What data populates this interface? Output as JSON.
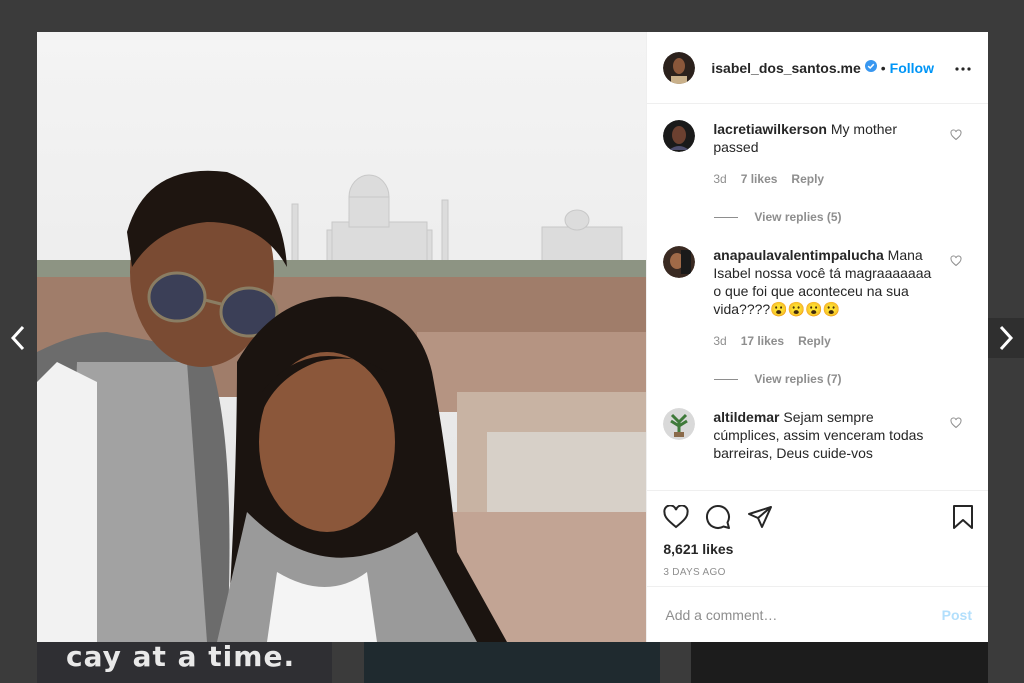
{
  "background": {
    "story_text": "cay at a time."
  },
  "post": {
    "author": {
      "username": "isabel_dos_santos.me",
      "verified": true,
      "follow_label": "Follow"
    },
    "comments": [
      {
        "username": "lacretiawilkerson",
        "text": "My mother passed",
        "time": "3d",
        "likes": "7 likes",
        "reply_label": "Reply",
        "view_replies": "View replies (5)"
      },
      {
        "username": "anapaulavalentimpalucha",
        "text": "Mana Isabel nossa você tá magraaaaaaa o que foi que aconteceu na sua vida????😮😮😮😮",
        "time": "3d",
        "likes": "17 likes",
        "reply_label": "Reply",
        "view_replies": "View replies (7)"
      },
      {
        "username": "altildemar",
        "text": "Sejam sempre cúmplices, assim venceram todas barreiras, Deus cuide-vos",
        "time": "",
        "likes": "",
        "reply_label": "",
        "view_replies": ""
      }
    ],
    "like_count": "8,621 likes",
    "posted": "3 DAYS AGO",
    "comment_placeholder": "Add a comment…",
    "post_label": "Post"
  },
  "colors": {
    "accent": "#0095f6",
    "verified": "#3897f0",
    "post_disabled": "#b2dffc"
  },
  "icons": [
    "chevron-left-icon",
    "chevron-right-icon",
    "verified-badge-icon",
    "more-icon",
    "heart-icon",
    "comment-icon",
    "share-icon",
    "bookmark-icon"
  ]
}
